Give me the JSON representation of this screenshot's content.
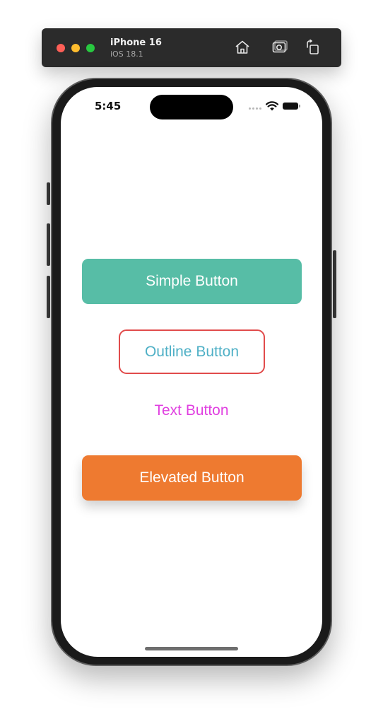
{
  "simulator": {
    "device_name": "iPhone 16",
    "os_version": "iOS 18.1",
    "icons": {
      "home": "home-icon",
      "screenshot": "screenshot-icon",
      "rotate": "rotate-icon"
    }
  },
  "status_bar": {
    "time": "5:45",
    "icons": [
      "cellular-signal-icon",
      "wifi-icon",
      "battery-icon"
    ]
  },
  "buttons": {
    "simple": {
      "label": "Simple Button",
      "color": "#57bda6"
    },
    "outline": {
      "label": "Outline Button",
      "border_color": "#e14b4b",
      "text_color": "#4fb0c6"
    },
    "text": {
      "label": "Text Button",
      "color": "#e040e0"
    },
    "elevated": {
      "label": "Elevated Button",
      "color": "#ee7a30"
    }
  }
}
